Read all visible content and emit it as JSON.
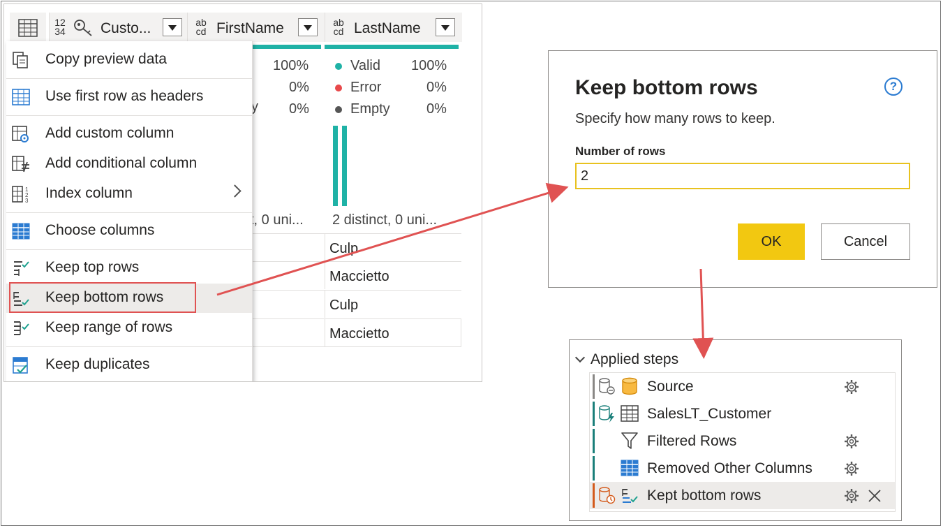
{
  "grid": {
    "columns": [
      {
        "type_top": "12",
        "type_bottom": "34",
        "label": "Custo..."
      },
      {
        "type_top": "ab",
        "type_bottom": "cd",
        "label": "FirstName"
      },
      {
        "type_top": "ab",
        "type_bottom": "cd",
        "label": "LastName"
      }
    ],
    "partial_stats": {
      "pct_valid": "100%",
      "pct_error": "0%",
      "pct_empty": "0%",
      "suffix_y": "y",
      "distinct_partial": "t, 0 uni..."
    },
    "lastname_stats": {
      "valid_label": "Valid",
      "valid_pct": "100%",
      "error_label": "Error",
      "error_pct": "0%",
      "empty_label": "Empty",
      "empty_pct": "0%",
      "distinct": "2 distinct, 0 uni..."
    },
    "lastname_rows": [
      "Culp",
      "Maccietto",
      "Culp",
      "Maccietto"
    ],
    "colors": {
      "valid": "#1fb2a6",
      "error": "#e8494b",
      "empty": "#555555"
    }
  },
  "menu": {
    "items": [
      {
        "label": "Copy preview data",
        "icon": "copy-icon"
      },
      {
        "label": "Use first row as headers",
        "icon": "table-icon"
      },
      {
        "label": "Add custom column",
        "icon": "custom-column-icon"
      },
      {
        "label": "Add conditional column",
        "icon": "conditional-column-icon"
      },
      {
        "label": "Index column",
        "icon": "index-column-icon"
      },
      {
        "label": "Choose columns",
        "icon": "choose-columns-icon"
      },
      {
        "label": "Keep top rows",
        "icon": "keep-top-rows-icon"
      },
      {
        "label": "Keep bottom rows",
        "icon": "keep-bottom-rows-icon"
      },
      {
        "label": "Keep range of rows",
        "icon": "keep-range-rows-icon"
      },
      {
        "label": "Keep duplicates",
        "icon": "keep-duplicates-icon"
      }
    ]
  },
  "dialog": {
    "title": "Keep bottom rows",
    "help": "?",
    "subtitle": "Specify how many rows to keep.",
    "field_label": "Number of rows",
    "field_value": "2",
    "ok_label": "OK",
    "cancel_label": "Cancel"
  },
  "applied_steps": {
    "header": "Applied steps",
    "steps": [
      {
        "label": "Source",
        "icon": "database-icon"
      },
      {
        "label": "SalesLT_Customer",
        "icon": "table-icon"
      },
      {
        "label": "Filtered Rows",
        "icon": "filter-icon"
      },
      {
        "label": "Removed Other Columns",
        "icon": "choose-columns-icon"
      },
      {
        "label": "Kept bottom rows",
        "icon": "keep-bottom-rows-icon"
      }
    ]
  }
}
